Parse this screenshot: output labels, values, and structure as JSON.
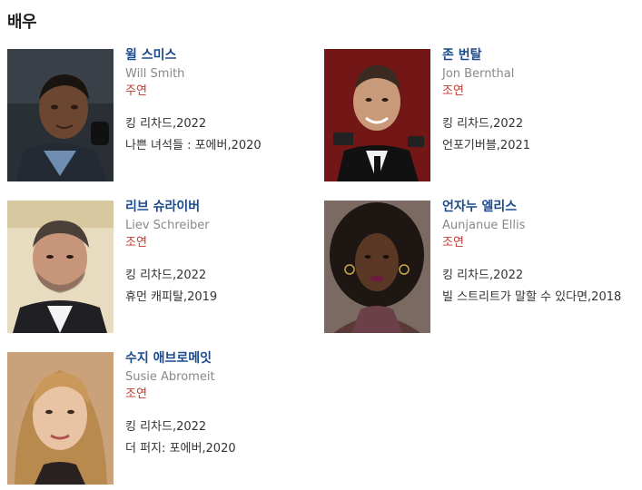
{
  "section": {
    "title": "배우"
  },
  "actors": [
    {
      "name_ko": "윌 스미스",
      "name_en": "Will Smith",
      "role": "주연",
      "works": [
        "킹 리차드,2022",
        "나쁜 녀석들 : 포에버,2020"
      ]
    },
    {
      "name_ko": "존 번탈",
      "name_en": "Jon Bernthal",
      "role": "조연",
      "works": [
        "킹 리차드,2022",
        "언포기버블,2021"
      ]
    },
    {
      "name_ko": "리브 슈라이버",
      "name_en": "Liev Schreiber",
      "role": "조연",
      "works": [
        "킹 리차드,2022",
        "휴먼 캐피탈,2019"
      ]
    },
    {
      "name_ko": "언자누 엘리스",
      "name_en": "Aunjanue Ellis",
      "role": "조연",
      "works": [
        "킹 리차드,2022",
        "빌 스트리트가 말할 수 있다면,2018"
      ]
    },
    {
      "name_ko": "수지 애브로메잇",
      "name_en": "Susie Abromeit",
      "role": "조연",
      "works": [
        "킹 리차드,2022",
        "더 퍼지: 포에버,2020"
      ]
    }
  ]
}
